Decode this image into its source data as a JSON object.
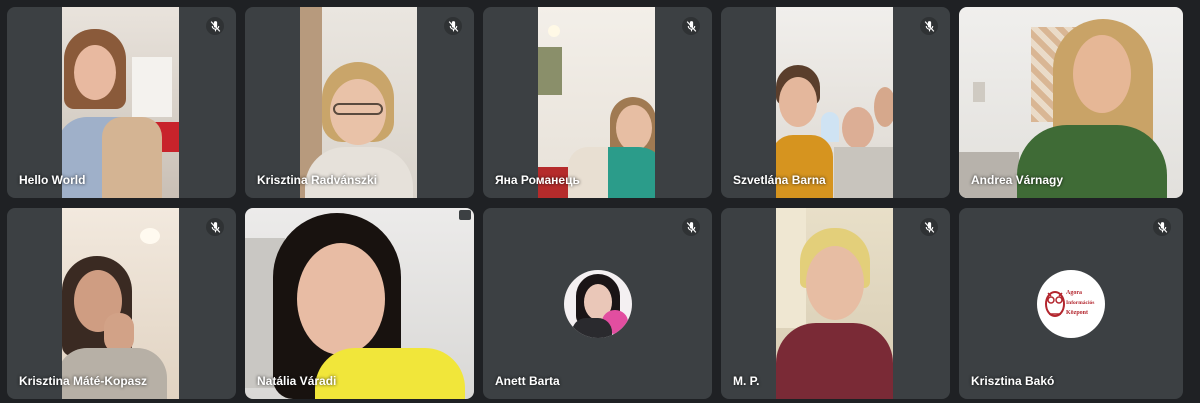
{
  "participants": [
    {
      "name": "Hello World",
      "muted": true
    },
    {
      "name": "Krisztina Radvánszki",
      "muted": true
    },
    {
      "name": "Яна Романець",
      "muted": true
    },
    {
      "name": "Szvetlána Barna",
      "muted": true
    },
    {
      "name": "Andrea Várnagy",
      "muted": false
    },
    {
      "name": "Krisztina Máté-Kopasz",
      "muted": true
    },
    {
      "name": "Natália Váradi",
      "muted": false
    },
    {
      "name": "Anett Barta",
      "muted": true
    },
    {
      "name": "M. P.",
      "muted": true
    },
    {
      "name": "Krisztina Bakó",
      "muted": true
    }
  ],
  "logo": {
    "line1": "Agora",
    "line2": "Információs",
    "line3": "Központ"
  },
  "icons": {
    "mic": "mic-off-icon"
  },
  "colors": {
    "tile_bg": "#3c4043",
    "page_bg": "#1f2124",
    "name_text": "#ffffff"
  }
}
